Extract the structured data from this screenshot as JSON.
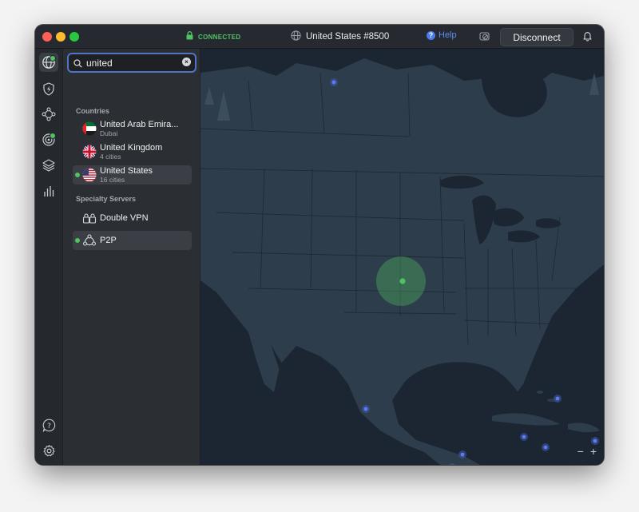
{
  "titlebar": {
    "status": "CONNECTED",
    "server": "United States #8500",
    "help": "Help",
    "disconnect": "Disconnect"
  },
  "search": {
    "value": "united",
    "placeholder": "Search",
    "clear_label": "×"
  },
  "sections": {
    "countries": "Countries",
    "specialty": "Specialty Servers"
  },
  "countries": [
    {
      "name": "United Arab Emira...",
      "sub": "Dubai",
      "icon": "flag-uae"
    },
    {
      "name": "United Kingdom",
      "sub": "4 cities",
      "icon": "flag-uk"
    },
    {
      "name": "United States",
      "sub": "16 cities",
      "icon": "flag-us",
      "selected": true,
      "connected": true
    }
  ],
  "specialty": [
    {
      "name": "Double VPN",
      "icon": "double-vpn-icon"
    },
    {
      "name": "P2P",
      "icon": "p2p-icon",
      "selected": true,
      "connected": true
    }
  ],
  "zoom": {
    "out": "−",
    "in": "+"
  },
  "colors": {
    "accent_green": "#4fc360",
    "accent_blue": "#4f74c9",
    "map_land": "#2d3b4a",
    "map_water": "#1b2632"
  }
}
